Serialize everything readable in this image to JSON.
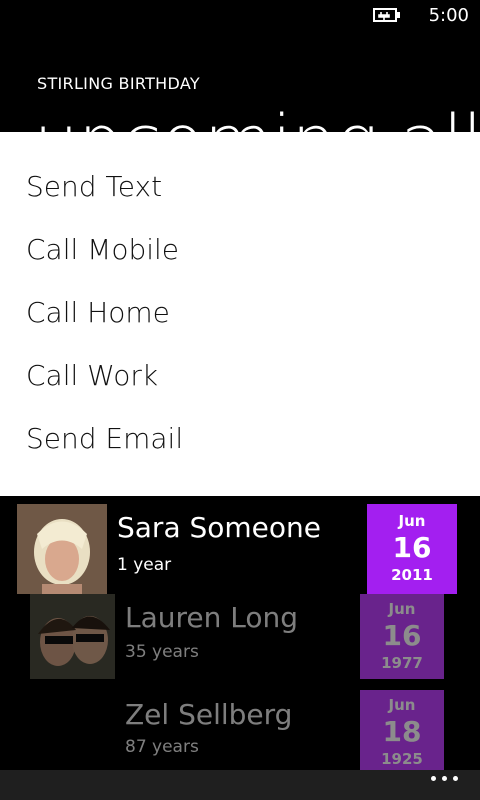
{
  "status": {
    "time": "5:00"
  },
  "app": {
    "title": "STIRLING BIRTHDAY",
    "page_title": "upcoming all r"
  },
  "menu": {
    "items": [
      "Send Text",
      "Call Mobile",
      "Call Home",
      "Call Work",
      "Send Email"
    ]
  },
  "contacts": [
    {
      "name": "Sara Someone",
      "age": "1 year",
      "month": "Jun",
      "day": "16",
      "year": "2011"
    },
    {
      "name": "Lauren Long",
      "age": "35 years",
      "month": "Jun",
      "day": "16",
      "year": "1977"
    },
    {
      "name": "Zel Sellberg",
      "age": "87 years",
      "month": "Jun",
      "day": "18",
      "year": "1925"
    }
  ],
  "colors": {
    "accent": "#8c14dc",
    "background": "#000000",
    "menu": "#ffffff"
  },
  "icons": {
    "battery": "battery-charging-icon",
    "more": "more-options-icon"
  }
}
